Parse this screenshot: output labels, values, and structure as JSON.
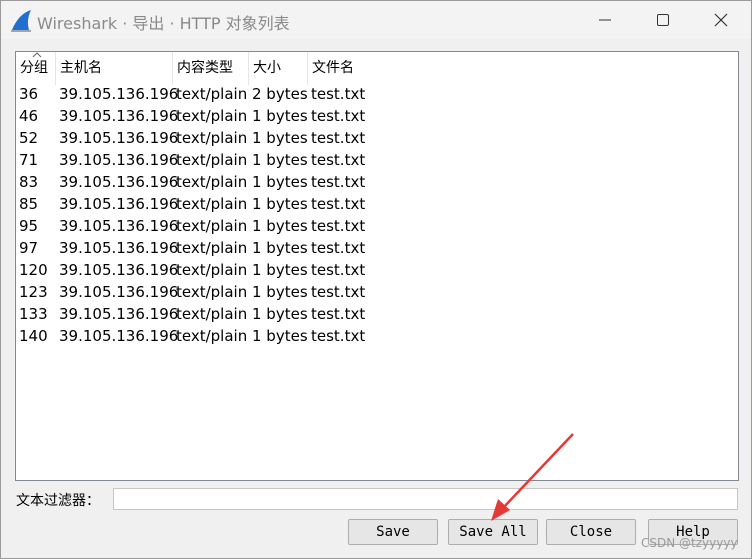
{
  "window": {
    "title": "Wireshark · 导出 · HTTP 对象列表"
  },
  "table": {
    "columns": [
      "分组",
      "主机名",
      "内容类型",
      "大小",
      "文件名"
    ],
    "rows": [
      [
        "36",
        "39.105.136.196",
        "text/plain",
        "2 bytes",
        "test.txt"
      ],
      [
        "46",
        "39.105.136.196",
        "text/plain",
        "1 bytes",
        "test.txt"
      ],
      [
        "52",
        "39.105.136.196",
        "text/plain",
        "1 bytes",
        "test.txt"
      ],
      [
        "71",
        "39.105.136.196",
        "text/plain",
        "1 bytes",
        "test.txt"
      ],
      [
        "83",
        "39.105.136.196",
        "text/plain",
        "1 bytes",
        "test.txt"
      ],
      [
        "85",
        "39.105.136.196",
        "text/plain",
        "1 bytes",
        "test.txt"
      ],
      [
        "95",
        "39.105.136.196",
        "text/plain",
        "1 bytes",
        "test.txt"
      ],
      [
        "97",
        "39.105.136.196",
        "text/plain",
        "1 bytes",
        "test.txt"
      ],
      [
        "120",
        "39.105.136.196",
        "text/plain",
        "1 bytes",
        "test.txt"
      ],
      [
        "123",
        "39.105.136.196",
        "text/plain",
        "1 bytes",
        "test.txt"
      ],
      [
        "133",
        "39.105.136.196",
        "text/plain",
        "1 bytes",
        "test.txt"
      ],
      [
        "140",
        "39.105.136.196",
        "text/plain",
        "1 bytes",
        "test.txt"
      ]
    ]
  },
  "filter": {
    "label": "文本过滤器：",
    "value": ""
  },
  "buttons": {
    "save": "Save",
    "save_all": "Save All",
    "close": "Close",
    "help": "Help"
  },
  "watermark": "CSDN @tzyyyyy",
  "colors": {
    "annotation_arrow": "#e53935",
    "wireshark_fin": "#1f6fd1"
  },
  "icons": [
    "wireshark-fin-icon",
    "minimize-icon",
    "maximize-icon",
    "close-icon",
    "sort-up-icon"
  ]
}
